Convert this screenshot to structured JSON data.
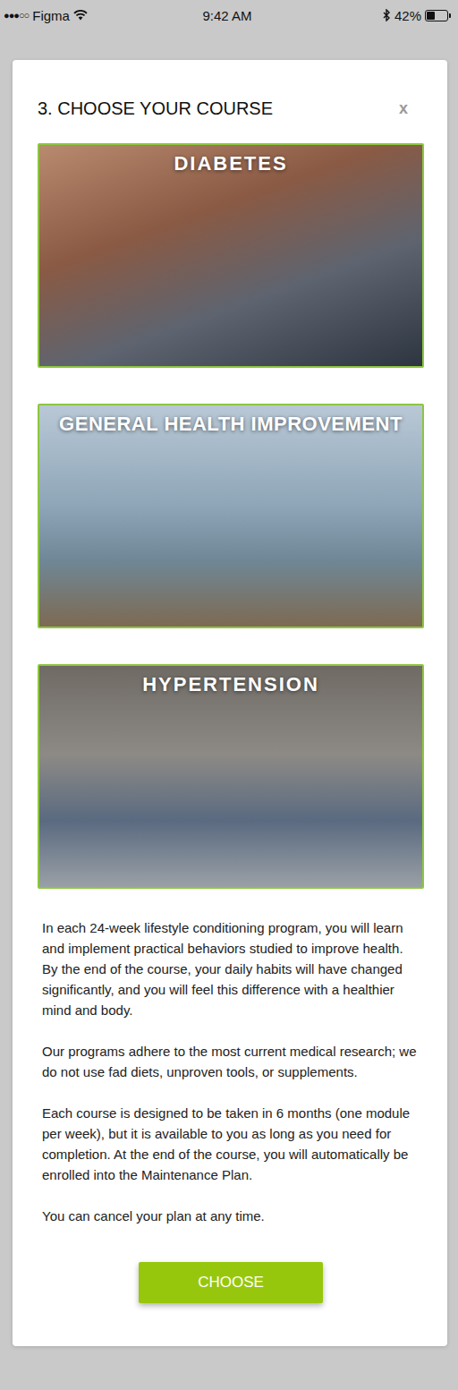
{
  "status_bar": {
    "signal": "●●●○○",
    "carrier": "Figma",
    "time": "9:42 AM",
    "battery": "42%",
    "battery_level": 0.42
  },
  "modal": {
    "title": "3. CHOOSE YOUR COURSE",
    "close": "x",
    "courses": [
      {
        "name": "DIABETES"
      },
      {
        "name": "GENERAL HEALTH IMPROVEMENT"
      },
      {
        "name": "HYPERTENSION"
      }
    ],
    "paragraphs": [
      "In each 24-week lifestyle conditioning program, you will learn and implement practical behaviors studied to improve health. By the end of the course, your daily habits will have changed significantly, and you will feel this difference with a healthier mind and body.",
      "Our programs adhere to the most current medical research; we do not use fad diets, unproven tools, or supplements.",
      "Each course is designed to be taken in 6 months (one module per week), but it is available to you as long as you need for completion. At the end of the course, you will automatically be enrolled into the Maintenance Plan.",
      "You can cancel your plan at any time."
    ],
    "button": "CHOOSE"
  }
}
